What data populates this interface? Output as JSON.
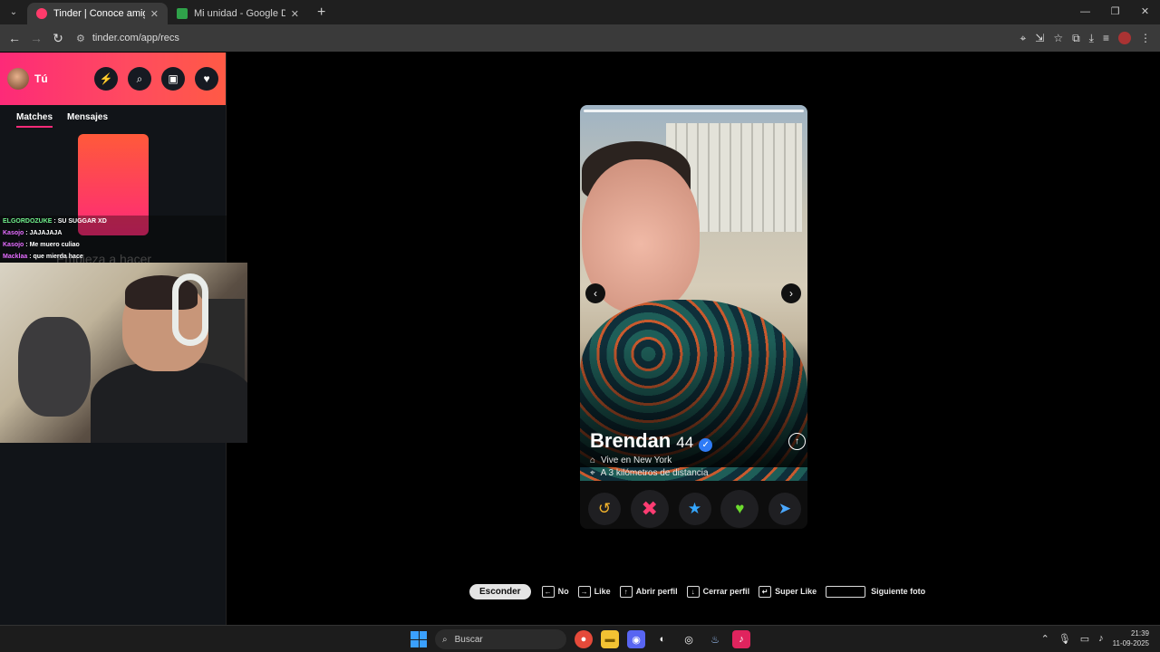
{
  "browser": {
    "tabs": [
      {
        "title": "Tinder | Conoce amigos y gente",
        "favicon_color": "#ff3b6b",
        "active": true
      },
      {
        "title": "Mi unidad - Google Drive",
        "favicon_color": "#2fa24a",
        "active": false
      }
    ],
    "url": "tinder.com/app/recs"
  },
  "sidebar": {
    "me_label": "Tú",
    "tabs": [
      "Matches",
      "Mensajes"
    ],
    "empty_text": "Empieza a hacer"
  },
  "chat": [
    {
      "user": "ELGORDOZUKE",
      "text": "SU SUGGAR XD"
    },
    {
      "user": "Kasojo",
      "text": "JAJAJAJA"
    },
    {
      "user": "Kasojo",
      "text": "Me muero culiao"
    },
    {
      "user": "Macklaa",
      "text": "que mierda hace"
    }
  ],
  "profile": {
    "name": "Brendan",
    "age": "44",
    "lives": "Vive en New York",
    "distance": "A 3 kilómetros de distancia"
  },
  "hints": {
    "hide": "Esconder",
    "items": [
      "No",
      "Like",
      "Abrir perfil",
      "Cerrar perfil",
      "Super Like",
      "Siguiente foto"
    ]
  },
  "taskbar": {
    "search": "Buscar",
    "time": "21:39",
    "date": "11-09-2025"
  },
  "colors": {
    "brand": "#fd2a78",
    "accent": "#ff5a45"
  }
}
